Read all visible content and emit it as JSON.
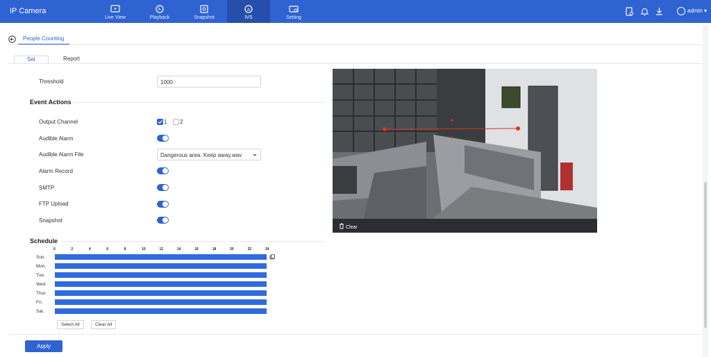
{
  "app": {
    "title": "IP Camera"
  },
  "nav": [
    {
      "label": "Live View",
      "icon": "live-view-icon"
    },
    {
      "label": "Playback",
      "icon": "playback-icon"
    },
    {
      "label": "Snapshot",
      "icon": "snapshot-icon"
    },
    {
      "label": "IVS",
      "icon": "ivs-icon",
      "active": true
    },
    {
      "label": "Setting",
      "icon": "setting-icon"
    }
  ],
  "header": {
    "user": "admin"
  },
  "page": {
    "title": "People Counting",
    "tabs": [
      "Set",
      "Report"
    ],
    "active_tab": "Set"
  },
  "form": {
    "threshold_label": "Threshold",
    "threshold_value": "1000",
    "event_actions_title": "Event Actions",
    "output_channel_label": "Output Channel",
    "output_channel_options": [
      "1",
      "2"
    ],
    "audible_alarm_label": "Audible Alarm",
    "audible_alarm_file_label": "Audible Alarm File",
    "audible_alarm_file_value": "Dangerous area. Keep away.wav",
    "alarm_record_label": "Alarm Record",
    "smtp_label": "SMTP",
    "ftp_upload_label": "FTP Upload",
    "snapshot_label": "Snapshot",
    "toggles": {
      "audible_alarm": true,
      "alarm_record": true,
      "smtp": true,
      "ftp_upload": true,
      "snapshot": true
    },
    "output_channel_checked": {
      "1": true,
      "2": false
    }
  },
  "schedule": {
    "title": "Schedule",
    "hours": [
      "0",
      "2",
      "4",
      "6",
      "8",
      "10",
      "12",
      "14",
      "16",
      "18",
      "20",
      "22",
      "24"
    ],
    "days": [
      "Sun.",
      "Mon.",
      "Tue.",
      "Wed.",
      "Thur.",
      "Fri.",
      "Sat."
    ],
    "select_all_label": "Select All",
    "clear_all_label": "Clear All"
  },
  "video": {
    "clear_label": "Clear"
  },
  "apply_label": "Apply",
  "colors": {
    "accent": "#2f63d1",
    "schedule": "#2f6bdc",
    "line": "#e0311f"
  }
}
